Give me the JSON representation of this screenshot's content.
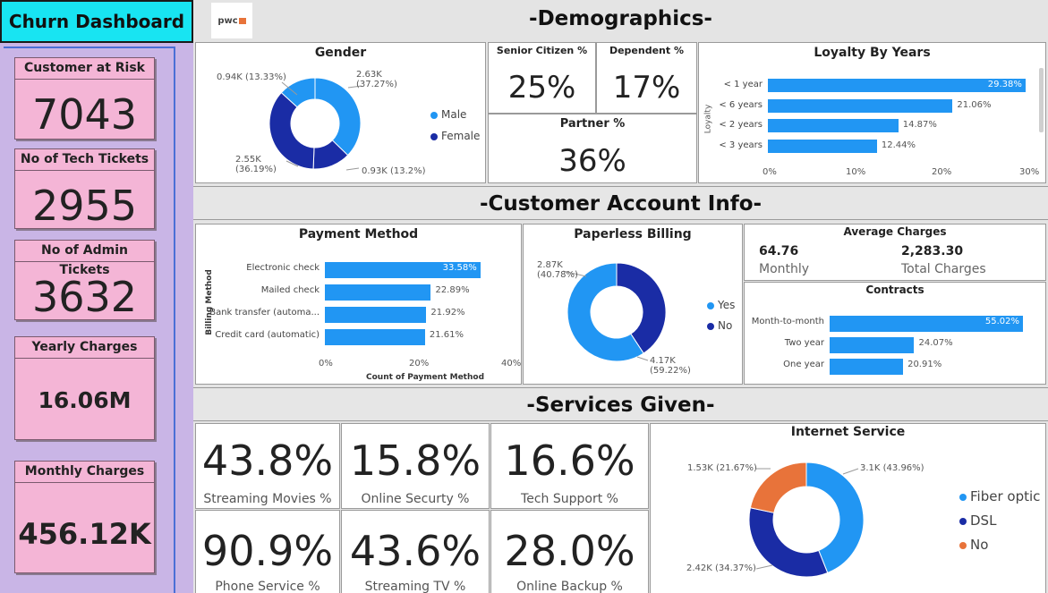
{
  "title": "Churn Dashboard",
  "logo_text": "pwc",
  "colors": {
    "accent_blue": "#2196f3",
    "dark_blue": "#1a2ca5",
    "orange": "#e8733a",
    "title_bg": "#18e4f2",
    "kpi_bg": "#f4b5d6",
    "sidebar_bg": "#c9b5e6"
  },
  "sidebar": {
    "kpis": [
      {
        "label": "Customer at Risk",
        "value": "7043"
      },
      {
        "label": "No of Tech Tickets",
        "value": "2955"
      },
      {
        "label": "No of Admin Tickets",
        "value": "3632"
      },
      {
        "label": "Yearly Charges",
        "value": "16.06M"
      },
      {
        "label": "Monthly Charges",
        "value": "456.12K"
      }
    ]
  },
  "sections": {
    "demographics": "-Demographics-",
    "account": "-Customer Account Info-",
    "services": "-Services Given-"
  },
  "gender": {
    "title": "Gender",
    "legend": [
      "Male",
      "Female"
    ],
    "labels": [
      {
        "line1": "2.63K",
        "line2": "(37.27%)"
      },
      {
        "line1": "0.94K (13.33%)",
        "line2": ""
      },
      {
        "line1": "2.55K",
        "line2": "(36.19%)"
      },
      {
        "line1": "0.93K (13.2%)",
        "line2": ""
      }
    ]
  },
  "senior": {
    "label": "Senior Citizen %",
    "value": "25%"
  },
  "dependent": {
    "label": "Dependent %",
    "value": "17%"
  },
  "partner": {
    "label": "Partner %",
    "value": "36%"
  },
  "loyalty": {
    "title": "Loyalty By Years",
    "ylabel": "Loyalty",
    "ticks": [
      "0%",
      "10%",
      "20%",
      "30%"
    ]
  },
  "payment": {
    "title": "Payment Method",
    "ylabel": "Billing Method",
    "xlabel": "Count of Payment Method",
    "ticks": [
      "0%",
      "20%",
      "40%"
    ]
  },
  "paperless": {
    "title": "Paperless Billing",
    "legend": [
      "Yes",
      "No"
    ],
    "labels": [
      {
        "line1": "2.87K",
        "line2": "(40.78%)"
      },
      {
        "line1": "4.17K",
        "line2": "(59.22%)"
      }
    ]
  },
  "avg_charges": {
    "title": "Average Charges",
    "monthly_value": "64.76",
    "monthly_label": "Monthly",
    "total_value": "2,283.30",
    "total_label": "Total Charges"
  },
  "contracts": {
    "title": "Contracts"
  },
  "services": [
    {
      "value": "43.8%",
      "label": "Streaming Movies %"
    },
    {
      "value": "15.8%",
      "label": "Online Securty %"
    },
    {
      "value": "16.6%",
      "label": "Tech Support %"
    },
    {
      "value": "90.9%",
      "label": "Phone Service %"
    },
    {
      "value": "43.6%",
      "label": "Streaming TV %"
    },
    {
      "value": "28.0%",
      "label": "Online Backup %"
    }
  ],
  "internet": {
    "title": "Internet Service",
    "legend": [
      "Fiber optic",
      "DSL",
      "No"
    ],
    "labels": [
      "3.1K (43.96%)",
      "1.53K (21.67%)",
      "2.42K (34.37%)"
    ]
  },
  "chart_data": [
    {
      "type": "pie",
      "title": "Gender",
      "categories": [
        "Male",
        "Female",
        "Female",
        "Male"
      ],
      "values": [
        37.27,
        13.33,
        36.19,
        13.2
      ],
      "colors": [
        "#2196f3",
        "#1a2ca5",
        "#1a2ca5",
        "#2196f3"
      ]
    },
    {
      "type": "bar",
      "title": "Loyalty By Years",
      "categories": [
        "< 1 year",
        "< 6 years",
        "< 2 years",
        "< 3 years"
      ],
      "values": [
        29.38,
        21.06,
        14.87,
        12.44
      ],
      "value_labels": [
        "29.38%",
        "21.06%",
        "14.87%",
        "12.44%"
      ],
      "xlim": [
        0,
        30
      ]
    },
    {
      "type": "bar",
      "title": "Payment Method",
      "categories": [
        "Electronic check",
        "Mailed check",
        "Bank transfer (automa...",
        "Credit card (automatic)"
      ],
      "values": [
        33.58,
        22.89,
        21.92,
        21.61
      ],
      "value_labels": [
        "33.58%",
        "22.89%",
        "21.92%",
        "21.61%"
      ],
      "xlim": [
        0,
        40
      ]
    },
    {
      "type": "pie",
      "title": "Paperless Billing",
      "categories": [
        "No",
        "Yes"
      ],
      "values": [
        40.78,
        59.22
      ],
      "colors": [
        "#1a2ca5",
        "#2196f3"
      ]
    },
    {
      "type": "bar",
      "title": "Contracts",
      "categories": [
        "Month-to-month",
        "Two year",
        "One year"
      ],
      "values": [
        55.02,
        24.07,
        20.91
      ],
      "value_labels": [
        "55.02%",
        "24.07%",
        "20.91%"
      ],
      "xlim": [
        0,
        55.02
      ]
    },
    {
      "type": "pie",
      "title": "Internet Service",
      "categories": [
        "Fiber optic",
        "DSL",
        "No"
      ],
      "values": [
        43.96,
        34.37,
        21.67
      ],
      "colors": [
        "#2196f3",
        "#1a2ca5",
        "#e8733a"
      ]
    }
  ]
}
